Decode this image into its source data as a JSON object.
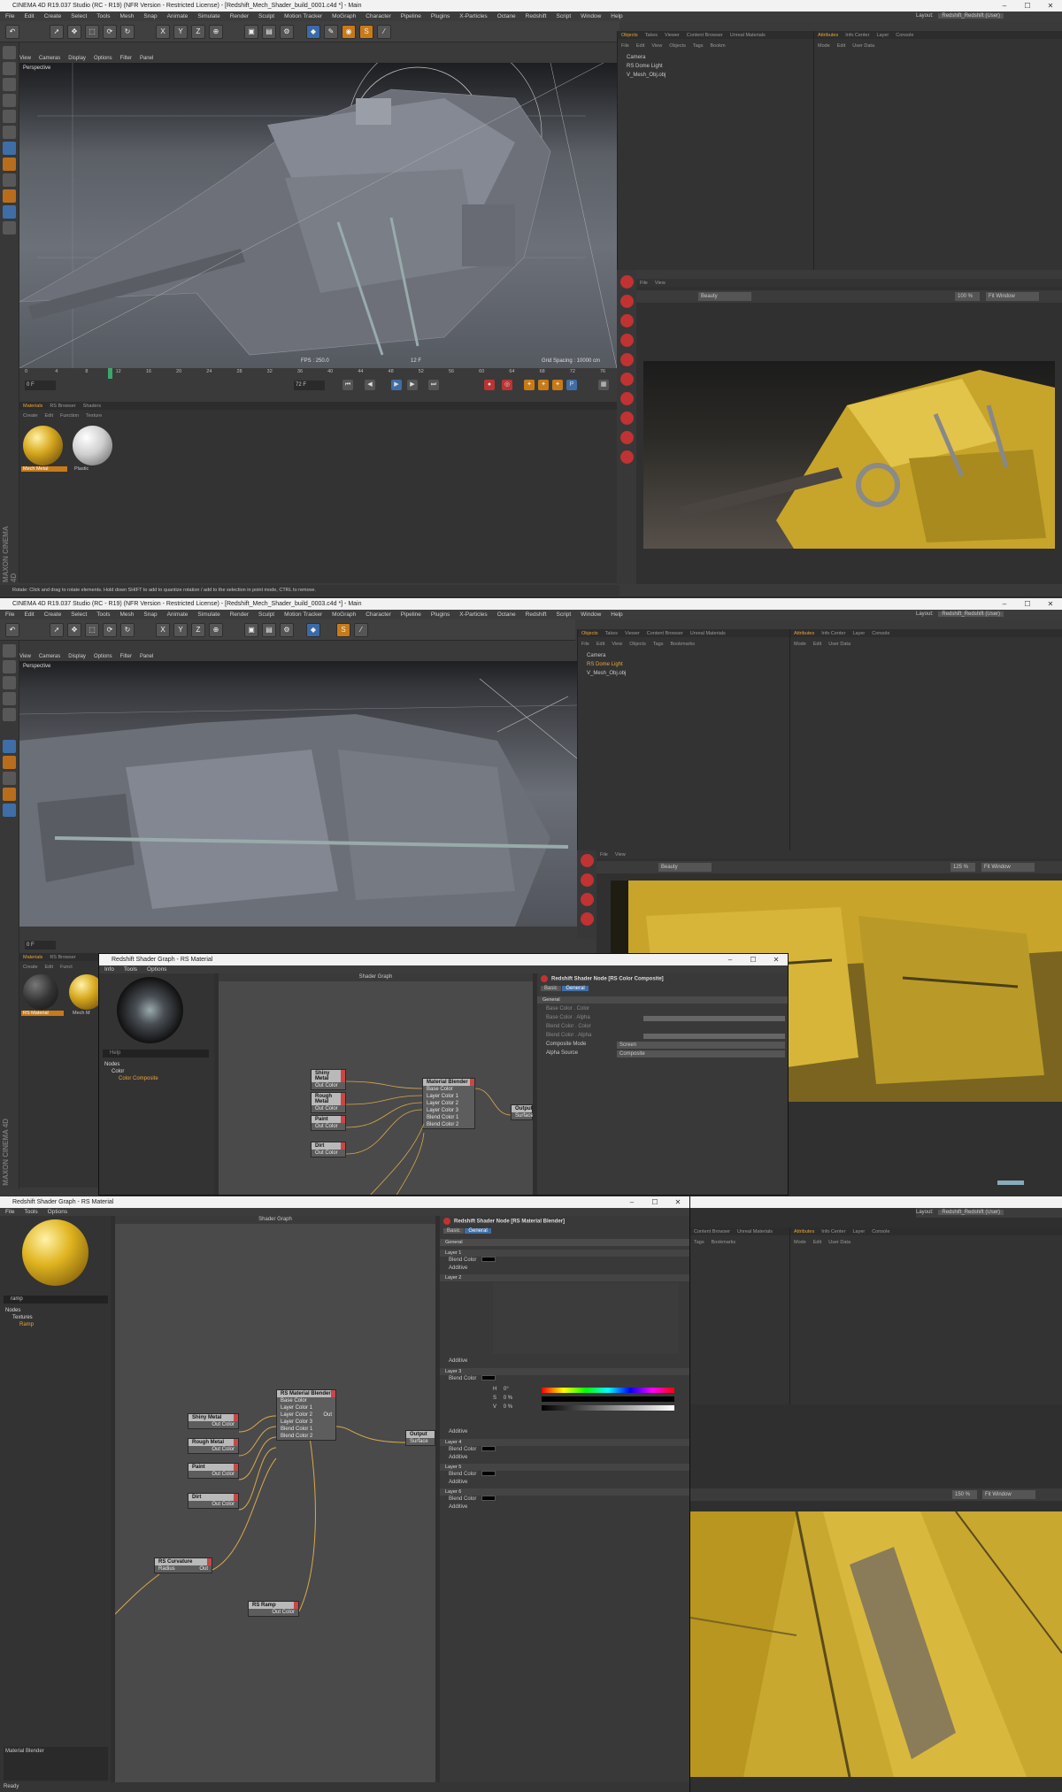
{
  "s1": {
    "title": "CINEMA 4D R19.037 Studio (RC - R19) (NFR Version - Restricted License) - [Redshift_Mech_Shader_build_0001.c4d *] - Main",
    "menu": [
      "File",
      "Edit",
      "Create",
      "Select",
      "Tools",
      "Mesh",
      "Snap",
      "Animate",
      "Simulate",
      "Render",
      "Sculpt",
      "Motion Tracker",
      "MoGraph",
      "Character",
      "Pipeline",
      "Plugins",
      "X-Particles",
      "Octane",
      "Redshift",
      "Script",
      "Window",
      "Help"
    ],
    "layout_label": "Layout:",
    "layout_value": "Redshift_Redshift (User)",
    "vp_menu": [
      "View",
      "Cameras",
      "Display",
      "Options",
      "Filter",
      "Panel"
    ],
    "vp_label": "Perspective",
    "fps": "FPS : 250.0",
    "frame": "12 F",
    "grid": "Grid Spacing : 10000 cm",
    "ticks": [
      "0",
      "4",
      "8",
      "12",
      "16",
      "20",
      "24",
      "28",
      "32",
      "36",
      "40",
      "44",
      "48",
      "52",
      "56",
      "60",
      "64",
      "68",
      "72",
      "76"
    ],
    "field_start": "0 F",
    "field_end": "72 F",
    "obj_tabs": [
      "Objects",
      "Takes",
      "Viewer",
      "Content Browser",
      "Unreal Materials"
    ],
    "obj_menu": [
      "File",
      "Edit",
      "View",
      "Objects",
      "Tags",
      "Bookm"
    ],
    "objects": [
      "Camera",
      "RS Dome Light",
      "V_Mesh_Obj.obj"
    ],
    "attr_tabs": [
      "Attributes",
      "Info Center",
      "Layer",
      "Console"
    ],
    "attr_menu": [
      "Mode",
      "Edit",
      "User Data"
    ],
    "rv_menu": [
      "File",
      "View"
    ],
    "rv_beauty": "Beauty",
    "rv_zoom": "100 %",
    "rv_fit": "Fit Window",
    "mat_tabs": [
      "Materials",
      "RS Browser",
      "Shaders"
    ],
    "mat_menu": [
      "Create",
      "Edit",
      "Function",
      "Texture"
    ],
    "materials": [
      "Mech Metal",
      "Plastic"
    ],
    "status": "Rotate: Click and drag to rotate elements. Hold down SHIFT to add to quantize rotation / add to the selection in point mode, CTRL to remove.",
    "brand": "MAXON CINEMA 4D"
  },
  "s2": {
    "title": "CINEMA 4D R19.037 Studio (RC - R19) (NFR Version - Restricted License) - [Redshift_Mech_Shader_build_0003.c4d *] - Main",
    "layout_value": "Redshift_Redshift (User)",
    "vp_label": "Perspective",
    "obj_tabs": [
      "Objects",
      "Takes",
      "Viewer",
      "Content Browser",
      "Unreal Materials"
    ],
    "obj_menu": [
      "File",
      "Edit",
      "View",
      "Objects",
      "Tags",
      "Bookmarks"
    ],
    "objects": [
      "Camera",
      "RS Dome Light",
      "V_Mesh_Obj.obj"
    ],
    "attr_tabs": [
      "Attributes",
      "Info Center",
      "Layer",
      "Console"
    ],
    "attr_menu": [
      "Mode",
      "Edit",
      "User Data"
    ],
    "rv_menu": [
      "File",
      "View"
    ],
    "rv_beauty": "Beauty",
    "rv_zoom": "125 %",
    "rv_fit": "Fit Window",
    "mat_tabs": [
      "Materials",
      "RS Browser"
    ],
    "mat_menu": [
      "Create",
      "Edit",
      "Funct"
    ],
    "materials": [
      "RS Material",
      "Mech M"
    ],
    "field_start": "0 F",
    "sg": {
      "title": "Redshift Shader Graph - RS Material",
      "menu": [
        "Info",
        "Tools",
        "Options"
      ],
      "search_placeholder": "Help",
      "tree_root": "Nodes",
      "tree_items": [
        "Color",
        "Color Composite"
      ],
      "graph_title": "Shader Graph",
      "node_header": "Redshift Shader Node [RS Color Composite]",
      "attr_tabs": [
        "Basic",
        "General"
      ],
      "section": "General",
      "attrs": [
        "Base Color . Color",
        "Base Color . Alpha",
        "Blend Color . Color",
        "Blend Color . Alpha",
        "Composite Mode",
        "Alpha Source"
      ],
      "composite_mode": "Screen",
      "alpha_source": "Composite",
      "nodes": [
        {
          "title": "Shiny Metal",
          "port": "Out Color"
        },
        {
          "title": "Rough Metal",
          "port": "Out Color"
        },
        {
          "title": "Paint",
          "port": "Out Color"
        },
        {
          "title": "Dirt",
          "port": "Out Color"
        }
      ],
      "blender": {
        "title": "Material Blender",
        "ports": [
          "Base Color",
          "Layer Color 1",
          "Layer Color 2",
          "Layer Color 3",
          "Blend Color 1",
          "Blend Color 2"
        ]
      },
      "output": {
        "title": "Output",
        "port": "Surface"
      }
    }
  },
  "s3": {
    "title": "Redshift Shader Graph - RS Material",
    "menu": [
      "File",
      "Tools",
      "Options"
    ],
    "search_value": "ramp",
    "tree_root": "Nodes",
    "tree_items": [
      "Textures",
      "Ramp"
    ],
    "graph_title": "Shader Graph",
    "node_header": "Redshift Shader Node [RS Material Blender]",
    "attr_tabs": [
      "Basic",
      "General"
    ],
    "section": "General",
    "layers": [
      "Layer 1",
      "Layer 2",
      "Layer 3",
      "Layer 4",
      "Layer 5",
      "Layer 6"
    ],
    "blend_color": "Blend Color",
    "additive": "Additive",
    "hsv": [
      "H",
      "S",
      "V"
    ],
    "hsv_values": [
      "0°",
      "0 %",
      "0 %"
    ],
    "nodes": [
      {
        "title": "Shiny Metal",
        "port": "Out Color"
      },
      {
        "title": "Rough Metal",
        "port": "Out Color"
      },
      {
        "title": "Paint",
        "port": "Out Color"
      },
      {
        "title": "Dirt",
        "port": "Out Color"
      }
    ],
    "blender": {
      "title": "RS Material Blender",
      "ports": [
        "Base Color",
        "Layer Color 1",
        "Layer Color 2",
        "Layer Color 3",
        "Blend Color 1",
        "Blend Color 2"
      ],
      "out": "Out"
    },
    "output": {
      "title": "Output",
      "port": "Surface"
    },
    "curvature": {
      "title": "RS Curvature",
      "port_in": "Radius",
      "port_out": "Out"
    },
    "ramp": {
      "title": "RS Ramp",
      "port": "Out Color"
    },
    "desc": "Material Blender",
    "status": "Ready",
    "c4d_tabs_right": [
      "Attributes",
      "Info Center",
      "Layer",
      "Console"
    ],
    "c4d_menu_right": [
      "Mode",
      "Edit",
      "User Data"
    ],
    "c4d_obj_tabs": [
      "Content Browser",
      "Unreal Materials"
    ],
    "c4d_obj_menu": [
      "Tags",
      "Bookmarks"
    ],
    "layout_label": "Layout:",
    "layout_value": "Redshift_Redshift (User)",
    "rv_zoom": "150 %",
    "rv_fit": "Fit Window"
  }
}
